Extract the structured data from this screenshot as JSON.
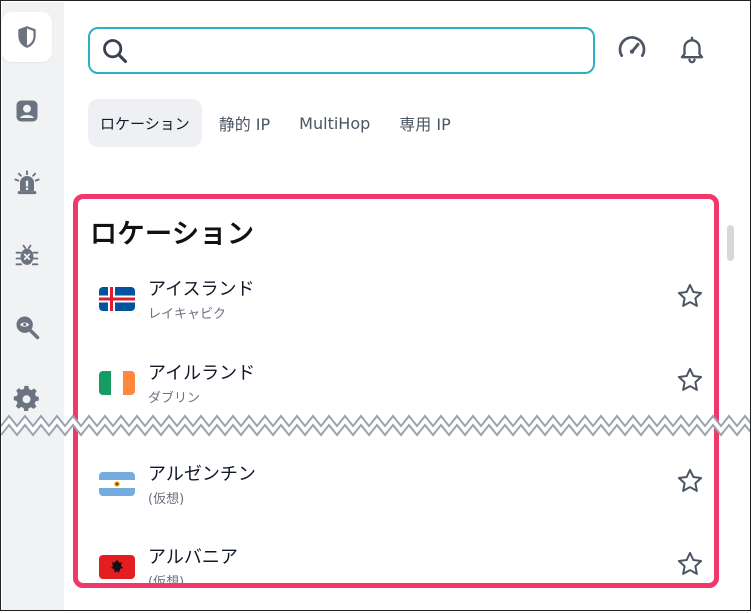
{
  "search": {
    "value": "",
    "placeholder": ""
  },
  "sidebar": {
    "items": [
      {
        "name": "shield",
        "active": true
      },
      {
        "name": "account"
      },
      {
        "name": "alert"
      },
      {
        "name": "bug"
      },
      {
        "name": "privacy-scan"
      },
      {
        "name": "settings"
      }
    ]
  },
  "header_icons": [
    "speed-gauge-icon",
    "bell-icon"
  ],
  "tabs": [
    {
      "label": "ロケーション",
      "active": true
    },
    {
      "label": "静的 IP"
    },
    {
      "label": "MultiHop"
    },
    {
      "label": "専用 IP"
    }
  ],
  "panel": {
    "title": "ロケーション",
    "locations": [
      {
        "name": "アイスランド",
        "sub": "レイキャビク",
        "flag": "iceland"
      },
      {
        "name": "アイルランド",
        "sub": "ダブリン",
        "flag": "ireland"
      },
      {
        "name": "アルゼンチン",
        "sub": "(仮想)",
        "flag": "argentina"
      },
      {
        "name": "アルバニア",
        "sub": "(仮想)",
        "flag": "albania"
      }
    ]
  },
  "colors": {
    "accent_search_border": "#27b3c2",
    "highlight_border": "#f0386b",
    "sidebar_bg": "#f1f2f4"
  }
}
